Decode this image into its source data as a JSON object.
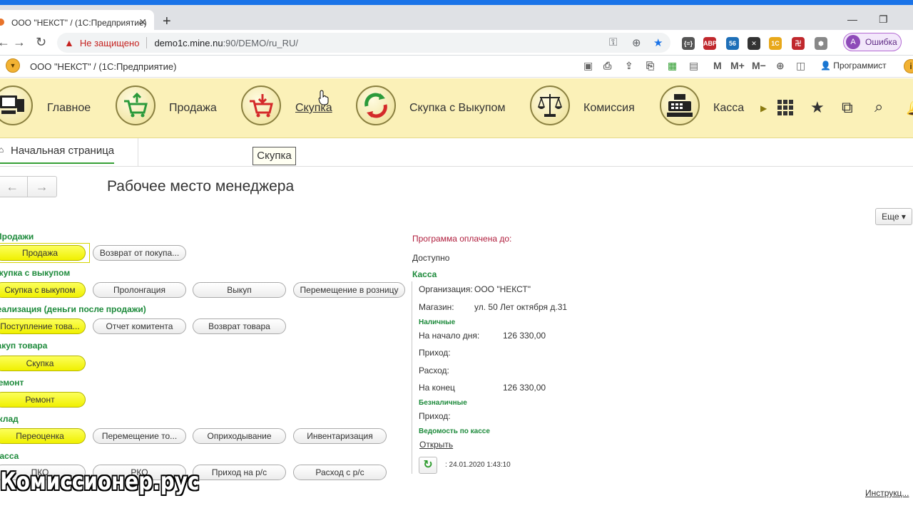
{
  "browser": {
    "tab_title": "ООО \"НЕКСТ\" / (1С:Предприятие)",
    "insecure_label": "Не защищено",
    "url_host": "demo1c.mine.nu",
    "url_path": ":90/DEMO/ru_RU/",
    "profile_initial": "A",
    "profile_label": "Ошибка",
    "extensions": [
      {
        "name": "json-ext",
        "label": "{≡}",
        "color": "#555555"
      },
      {
        "name": "adblock-ext",
        "label": "ABP",
        "color": "#c0282d"
      },
      {
        "name": "tab-ext",
        "label": "56",
        "color": "#1e6fb8"
      },
      {
        "name": "x-ext",
        "label": "✕",
        "color": "#333333"
      },
      {
        "name": "1c-ext",
        "label": "1С",
        "color": "#e8a81a"
      },
      {
        "name": "red-ext",
        "label": "卍",
        "color": "#c0282d"
      },
      {
        "name": "shield-ext",
        "label": "⬢",
        "color": "#888888"
      }
    ]
  },
  "app": {
    "title": "ООО \"НЕКСТ\" /   (1С:Предприятие)",
    "user": "Программист",
    "header_icons": [
      "M",
      "M+",
      "M−"
    ]
  },
  "sections": [
    {
      "label": "Главное",
      "icon": "computer-icon"
    },
    {
      "label": "Продажа",
      "icon": "cart-up-icon"
    },
    {
      "label": "Скупка",
      "icon": "cart-down-icon"
    },
    {
      "label": "Скупка с Выкупом",
      "icon": "cycle-arrows-icon"
    },
    {
      "label": "Комиссия",
      "icon": "scales-icon"
    },
    {
      "label": "Касса",
      "icon": "cash-register-icon"
    }
  ],
  "home_tab": "Начальная страница",
  "tooltip": "Скупка",
  "page_title": "Рабочее место менеджера",
  "more_button": "Еще ▾",
  "groups": [
    {
      "title": "Продажи",
      "buttons": [
        "Продажа",
        "Возврат от покупа..."
      ]
    },
    {
      "title": "Скупка с выкупом",
      "buttons": [
        "Скупка с выкупом",
        "Пролонгация",
        "Выкуп",
        "Перемещение в розницу"
      ]
    },
    {
      "title": "Реализация (деньги после продажи)",
      "buttons": [
        "Поступление това...",
        "Отчет комитента",
        "Возврат товара"
      ]
    },
    {
      "title": "Закуп товара",
      "buttons": [
        "Скупка"
      ]
    },
    {
      "title": "Ремонт",
      "buttons": [
        "Ремонт"
      ]
    },
    {
      "title": "Склад",
      "buttons": [
        "Переоценка",
        "Перемещение то...",
        "Оприходывание",
        "Инвентаризация"
      ]
    },
    {
      "title": "Касса",
      "buttons": [
        "ПКО",
        "РКО",
        "Приход на р/с",
        "Расход с р/с"
      ]
    }
  ],
  "right": {
    "paid_until": "Программа оплачена до:",
    "available": "Доступно",
    "kassa": "Касса",
    "org_label": "Организация:",
    "org_value": "ООО \"НЕКСТ\"",
    "shop_label": "Магазин:",
    "shop_value": "ул. 50 Лет октября д.31",
    "cash": "Наличные",
    "start_label": "На начало дня:",
    "start_value": "126 330,00",
    "income_label": "Приход:",
    "expense_label": "Расход:",
    "end_label": "На конец",
    "end_value": "126 330,00",
    "noncash": "Безналичные",
    "noncash_income_label": "Приход:",
    "report": "Ведомость по кассе",
    "open_link": "Открыть",
    "timestamp": ":   24.01.2020 1:43:10"
  },
  "watermark": "Комиссионер.рус",
  "instructions_link": "Инструкц..."
}
